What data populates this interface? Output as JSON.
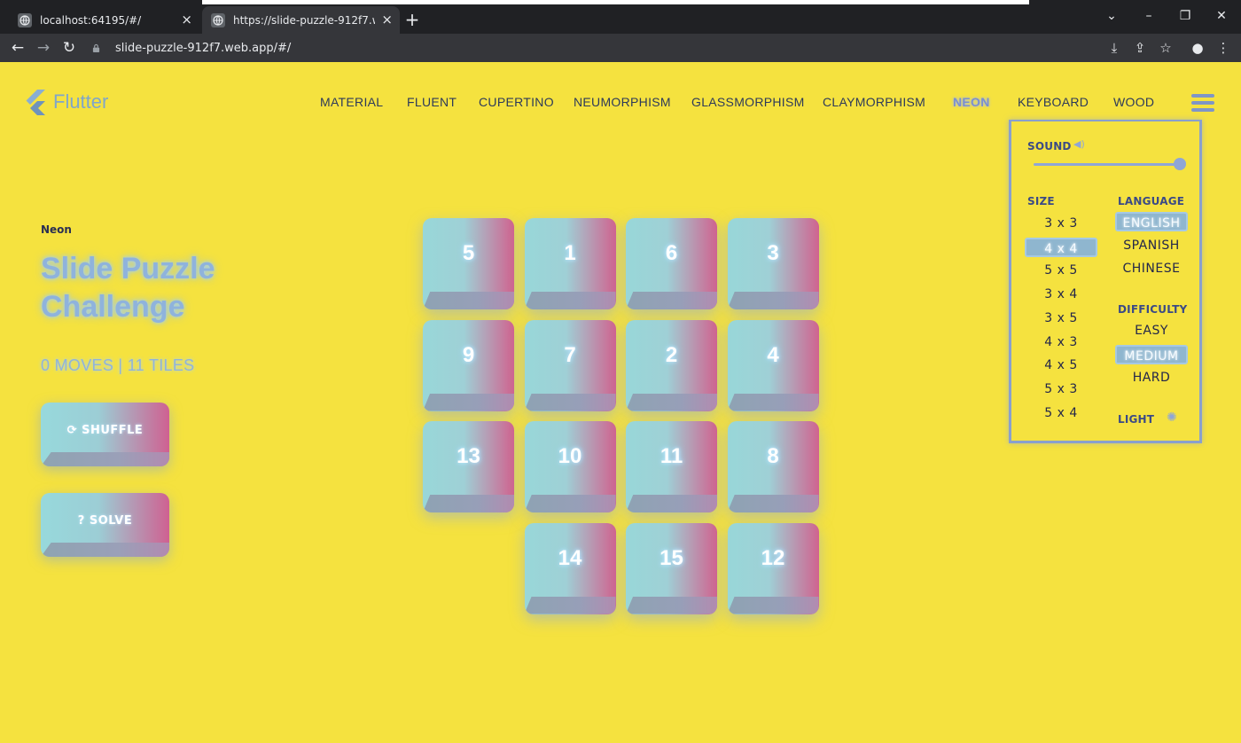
{
  "browser": {
    "tabs": [
      {
        "title": "localhost:64195/#/",
        "active": false
      },
      {
        "title": "https://slide-puzzle-912f7.web.app/#/",
        "active": true
      }
    ],
    "url": "slide-puzzle-912f7.web.app/#/"
  },
  "app": {
    "logo_text": "Flutter",
    "themes": [
      "MATERIAL",
      "FLUENT",
      "CUPERTINO",
      "NEUMORPHISM",
      "GLASSMORPHISM",
      "CLAYMORPHISM",
      "NEON",
      "KEYBOARD",
      "WOOD"
    ],
    "active_theme": "NEON",
    "left_panel": {
      "theme_name": "Neon",
      "title": "Slide Puzzle Challenge",
      "moves_text": "0 MOVES | 11 TILES",
      "shuffle_label": "⟳  SHUFFLE",
      "solve_label": "?  SOLVE"
    },
    "board": {
      "rows": 4,
      "cols": 4,
      "tiles": [
        5,
        1,
        6,
        3,
        9,
        7,
        2,
        4,
        13,
        10,
        11,
        8,
        null,
        14,
        15,
        12
      ]
    },
    "settings": {
      "sound_label": "SOUND",
      "size_label": "SIZE",
      "size_options": [
        "3 x 3",
        "4 x 4",
        "5 x 5",
        "3 x 4",
        "3 x 5",
        "4 x 3",
        "4 x 5",
        "5 x 3",
        "5 x 4"
      ],
      "size_selected": "4 x 4",
      "language_label": "LANGUAGE",
      "language_options": [
        "ENGLISH",
        "SPANISH",
        "CHINESE"
      ],
      "language_selected": "ENGLISH",
      "difficulty_label": "DIFFICULTY",
      "difficulty_options": [
        "EASY",
        "MEDIUM",
        "HARD"
      ],
      "difficulty_selected": "MEDIUM",
      "light_label": "LIGHT"
    },
    "colors": {
      "background": "#f5e23f",
      "tile_left": "#98d7d8",
      "tile_right": "#d0638f",
      "neon_blue": "#8fb3dc"
    }
  }
}
